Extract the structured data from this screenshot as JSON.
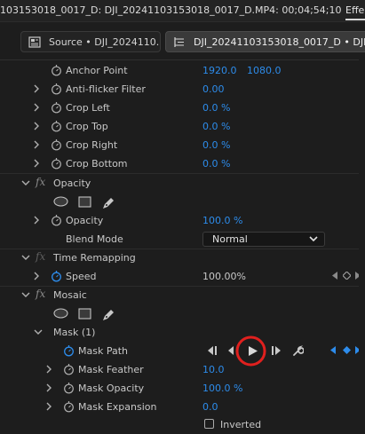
{
  "window": {
    "title": "103153018_0017_D: DJI_20241103153018_0017_D.MP4: 00;04;54;10",
    "effects_tab": "Effe"
  },
  "tabs": [
    {
      "label": "Source • DJI_2024110...",
      "active": false,
      "icon": "source-clip-icon"
    },
    {
      "label": "DJI_20241103153018_0017_D • DJI_2",
      "active": true,
      "icon": "effect-controls-icon"
    }
  ],
  "props": {
    "anchor_point": {
      "label": "Anchor Point",
      "x": "1920.0",
      "y": "1080.0"
    },
    "anti_flicker": {
      "label": "Anti-flicker Filter",
      "value": "0.00"
    },
    "crop_left": {
      "label": "Crop Left",
      "value": "0.0 %"
    },
    "crop_top": {
      "label": "Crop Top",
      "value": "0.0 %"
    },
    "crop_right": {
      "label": "Crop Right",
      "value": "0.0 %"
    },
    "crop_bottom": {
      "label": "Crop Bottom",
      "value": "0.0 %"
    }
  },
  "opacity": {
    "title": "Opacity",
    "opacity_label": "Opacity",
    "opacity_value": "100.0 %",
    "blend_label": "Blend Mode",
    "blend_value": "Normal"
  },
  "time_remapping": {
    "title": "Time Remapping",
    "speed_label": "Speed",
    "speed_value": "100.00%"
  },
  "mosaic": {
    "title": "Mosaic",
    "mask_title": "Mask (1)",
    "mask_path_label": "Mask Path",
    "mask_feather_label": "Mask Feather",
    "mask_feather_value": "10.0",
    "mask_opacity_label": "Mask Opacity",
    "mask_opacity_value": "100.0 %",
    "mask_expansion_label": "Mask Expansion",
    "mask_expansion_value": "0.0",
    "inverted_label": "Inverted",
    "inverted_checked": false
  },
  "colors": {
    "accent_blue": "#2d8ceb",
    "highlight_ring": "#e0201e",
    "panel_bg": "#1d1d1d"
  }
}
